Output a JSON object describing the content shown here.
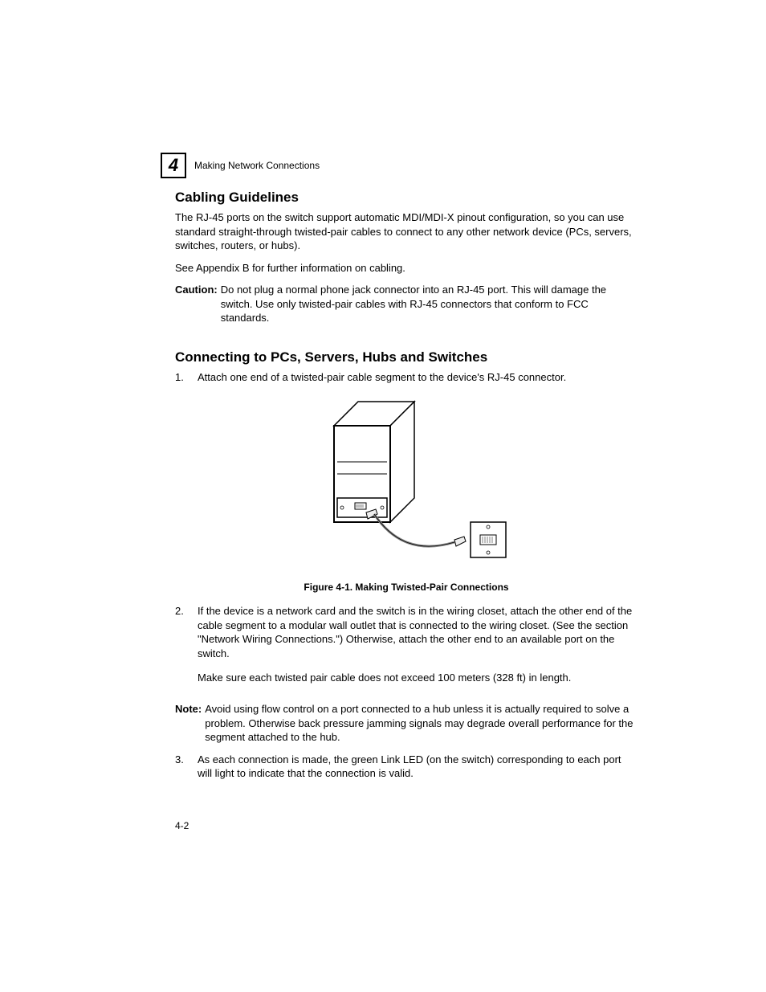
{
  "header": {
    "chapter_number": "4",
    "chapter_title": "Making Network Connections"
  },
  "section1": {
    "title": "Cabling Guidelines",
    "para1": "The RJ-45 ports on the switch support automatic MDI/MDI-X pinout configuration, so you can use standard straight-through twisted-pair cables to connect to any other network device (PCs, servers, switches, routers, or hubs).",
    "para2": "See Appendix B for further information on cabling.",
    "caution_label": "Caution:",
    "caution_text": "Do not plug a normal phone jack connector into an RJ-45 port. This will damage the switch. Use only twisted-pair cables with RJ-45 connectors that conform to FCC standards."
  },
  "section2": {
    "title": "Connecting to PCs, Servers, Hubs and Switches",
    "step1_num": "1.",
    "step1_text": "Attach one end of a twisted-pair cable segment to the device's RJ-45 connector.",
    "figure_caption": "Figure 4-1.  Making Twisted-Pair Connections",
    "step2_num": "2.",
    "step2_text": "If the device is a network card and the switch is in the wiring closet, attach the other end of the cable segment to a modular wall outlet that is connected to the wiring closet. (See the section \"Network Wiring Connections.\") Otherwise, attach the other end to an available port on the switch.",
    "step2_text2": "Make sure each twisted pair cable does not exceed 100 meters (328 ft) in length.",
    "note_label": "Note:",
    "note_text": "Avoid using flow control on a port connected to a hub unless it is actually required to solve a problem. Otherwise back pressure jamming signals may degrade overall performance for the segment attached to the hub.",
    "step3_num": "3.",
    "step3_text": "As each connection is made, the green Link LED (on the switch) corresponding to each port will light to indicate that the connection is valid."
  },
  "page_number": "4-2"
}
